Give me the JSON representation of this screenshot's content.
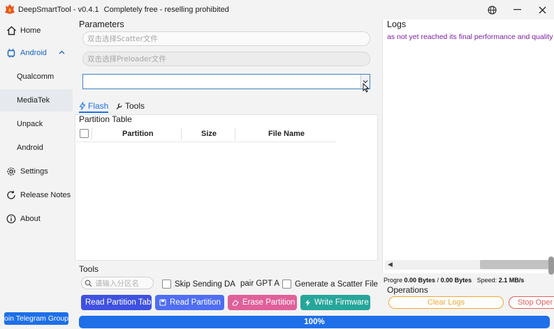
{
  "titlebar": {
    "app_name": "DeepSmartTool",
    "version": "v0.4.1",
    "tagline": "Completely free - reselling prohibited",
    "logo_icon": "flame-logo-icon"
  },
  "sidebar": {
    "items": [
      {
        "label": "Home",
        "icon": "home-icon"
      },
      {
        "label": "Android",
        "icon": "android-icon"
      },
      {
        "label": "Qualcomm"
      },
      {
        "label": "MediaTek"
      },
      {
        "label": "Unpack"
      },
      {
        "label": "Android"
      },
      {
        "label": "Settings",
        "icon": "gear-icon"
      },
      {
        "label": "Release Notes",
        "icon": "refresh-icon"
      },
      {
        "label": "About",
        "icon": "info-icon"
      }
    ],
    "telegram_label": "oin Telegram Group"
  },
  "parameters": {
    "title": "Parameters",
    "scatter_placeholder": "双击选择Scatter文件",
    "preloader_placeholder": "双击选择Preloader文件",
    "combo_value": ""
  },
  "tabs": {
    "flash": "Flash",
    "tools": "Tools"
  },
  "partition_table": {
    "title": "Partition Table",
    "columns": [
      "Partition",
      "Size",
      "File Name"
    ]
  },
  "tools": {
    "title": "Tools",
    "search_placeholder": "请输入分区名",
    "skip_da": "Skip Sending DA",
    "repair_gpt": "pair GPT A",
    "generate_scatter": "Generate a Scatter File",
    "buttons": {
      "read_table": "Read Partition Tab",
      "read_partition": "Read Partition",
      "erase_partition": "Erase Partition",
      "write_firmware": "Write Firmware"
    }
  },
  "logs": {
    "title": "Logs",
    "text": "as not yet reached its final performance and quality"
  },
  "progress_info": {
    "label": "Progre",
    "transferred": "0.00 Bytes",
    "separator": "/",
    "total": "0.00 Bytes",
    "speed_label": "Speed:",
    "speed": "2.1 MB/s"
  },
  "operations": {
    "title": "Operations",
    "clear_logs": "Clear Logs",
    "stop": "Stop Oper"
  },
  "progress": {
    "value": 1.0,
    "text": "100%"
  },
  "colors": {
    "accent": "#1e6fe8",
    "read_table": "#3f51e0",
    "read_partition": "#4f6ef2",
    "erase": "#e0609a",
    "write": "#26a69a",
    "clear_logs_border": "#f0a830",
    "stop_border": "#e0605a",
    "log_text": "#7b1fa2"
  }
}
